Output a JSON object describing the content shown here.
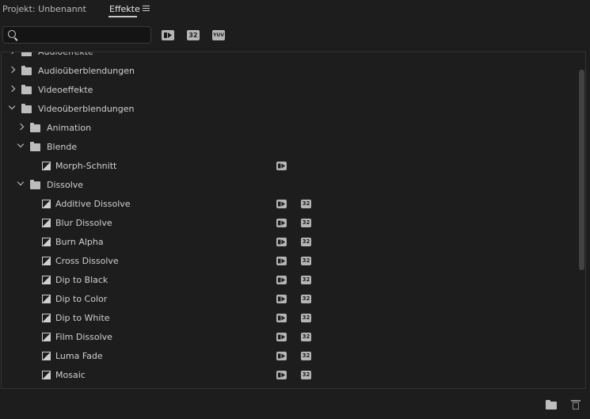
{
  "tabs": [
    {
      "label": "Projekt: Unbenannt",
      "active": false
    },
    {
      "label": "Effekte",
      "active": true
    }
  ],
  "search": {
    "value": "",
    "placeholder": ""
  },
  "filters": [
    {
      "icon": "accelerated-effects-icon",
      "label": ""
    },
    {
      "icon": "32-bit-icon",
      "label": "32"
    },
    {
      "icon": "yuv-icon",
      "label": "YUV"
    }
  ],
  "tree": [
    {
      "label": "Audioeffekte",
      "type": "folder",
      "level": 0,
      "expanded": false,
      "badges": []
    },
    {
      "label": "Audioüberblendungen",
      "type": "folder",
      "level": 0,
      "expanded": false,
      "badges": []
    },
    {
      "label": "Videoeffekte",
      "type": "folder",
      "level": 0,
      "expanded": false,
      "badges": []
    },
    {
      "label": "Videoüberblendungen",
      "type": "folder",
      "level": 0,
      "expanded": true,
      "badges": []
    },
    {
      "label": "Animation",
      "type": "folder",
      "level": 1,
      "expanded": false,
      "badges": []
    },
    {
      "label": "Blende",
      "type": "folder",
      "level": 1,
      "expanded": true,
      "badges": []
    },
    {
      "label": "Morph-Schnitt",
      "type": "effect",
      "level": 2,
      "badges": [
        "accelerated"
      ]
    },
    {
      "label": "Dissolve",
      "type": "folder",
      "level": 1,
      "expanded": true,
      "badges": []
    },
    {
      "label": "Additive Dissolve",
      "type": "effect",
      "level": 2,
      "badges": [
        "accelerated",
        "32"
      ]
    },
    {
      "label": "Blur Dissolve",
      "type": "effect",
      "level": 2,
      "badges": [
        "accelerated",
        "32"
      ]
    },
    {
      "label": "Burn Alpha",
      "type": "effect",
      "level": 2,
      "badges": [
        "accelerated",
        "32"
      ]
    },
    {
      "label": "Cross Dissolve",
      "type": "effect",
      "level": 2,
      "badges": [
        "accelerated",
        "32"
      ]
    },
    {
      "label": "Dip to Black",
      "type": "effect",
      "level": 2,
      "badges": [
        "accelerated",
        "32"
      ]
    },
    {
      "label": "Dip to Color",
      "type": "effect",
      "level": 2,
      "badges": [
        "accelerated",
        "32"
      ]
    },
    {
      "label": "Dip to White",
      "type": "effect",
      "level": 2,
      "badges": [
        "accelerated",
        "32"
      ]
    },
    {
      "label": "Film Dissolve",
      "type": "effect",
      "level": 2,
      "badges": [
        "accelerated",
        "32"
      ]
    },
    {
      "label": "Luma Fade",
      "type": "effect",
      "level": 2,
      "badges": [
        "accelerated",
        "32"
      ]
    },
    {
      "label": "Mosaic",
      "type": "effect",
      "level": 2,
      "badges": [
        "accelerated",
        "32"
      ]
    }
  ],
  "bottom_bar": {
    "new_folder_icon": "new-folder-icon",
    "delete_icon": "trash-icon"
  },
  "colors": {
    "background": "#1d1d1d",
    "text": "#c8c8c8",
    "badge": "#b5b5b5"
  }
}
